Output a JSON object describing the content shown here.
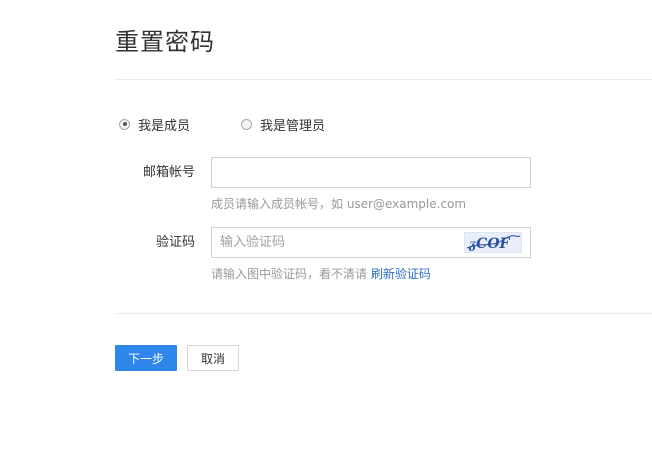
{
  "page": {
    "title": "重置密码"
  },
  "role": {
    "options": [
      {
        "label": "我是成员",
        "checked": true
      },
      {
        "label": "我是管理员",
        "checked": false
      }
    ]
  },
  "form": {
    "account": {
      "label": "邮箱帐号",
      "value": "",
      "placeholder": "",
      "hint": "成员请输入成员帐号，如 user@example.com"
    },
    "captcha": {
      "label": "验证码",
      "value": "",
      "placeholder": "输入验证码",
      "image_text": "ᵹCOF",
      "hint": "请输入图中验证码，看不清请",
      "refresh_link": "刷新验证码"
    }
  },
  "actions": {
    "next_label": "下一步",
    "cancel_label": "取消",
    "primary_color": "#2f86ea"
  }
}
